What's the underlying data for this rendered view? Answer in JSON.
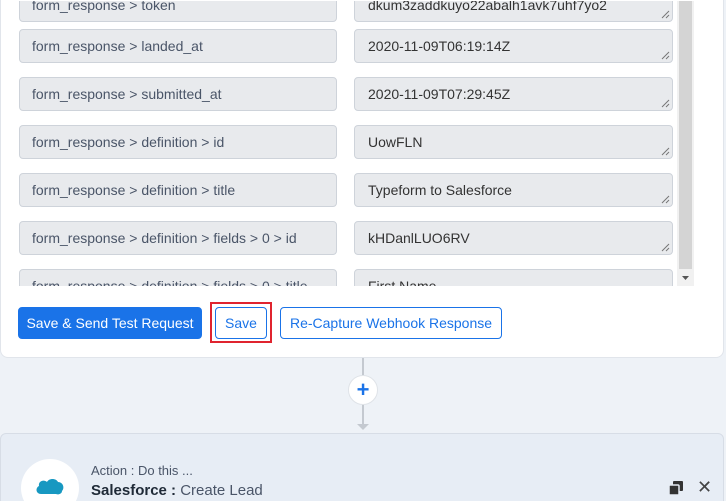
{
  "fields": [
    {
      "label": "form_response > token",
      "value": "dkum3zaddkuyo22abalh1avk7uhf7yo2"
    },
    {
      "label": "form_response > landed_at",
      "value": "2020-11-09T06:19:14Z"
    },
    {
      "label": "form_response > submitted_at",
      "value": "2020-11-09T07:29:45Z"
    },
    {
      "label": "form_response > definition > id",
      "value": "UowFLN"
    },
    {
      "label": "form_response > definition > title",
      "value": "Typeform to Salesforce"
    },
    {
      "label": "form_response > definition > fields > 0 > id",
      "value": "kHDanlLUO6RV"
    },
    {
      "label": "form_response > definition > fields > 0 > title",
      "value": "First Name"
    }
  ],
  "buttons": {
    "send_test": "Save & Send Test Request",
    "save": "Save",
    "recapture": "Re-Capture Webhook Response"
  },
  "add_step": {
    "symbol": "+"
  },
  "action": {
    "subtitle": "Action : Do this ...",
    "app": "Salesforce :",
    "event": "Create Lead",
    "logo_text": "salesforce",
    "close_symbol": "✕"
  },
  "colors": {
    "accent": "#1a73e8",
    "highlight": "#e0242f",
    "salesforce": "#1798c1"
  },
  "icons": {
    "copy": "copy-icon",
    "close": "close-icon",
    "plus": "plus-icon",
    "resize": "resize-grip-icon"
  }
}
